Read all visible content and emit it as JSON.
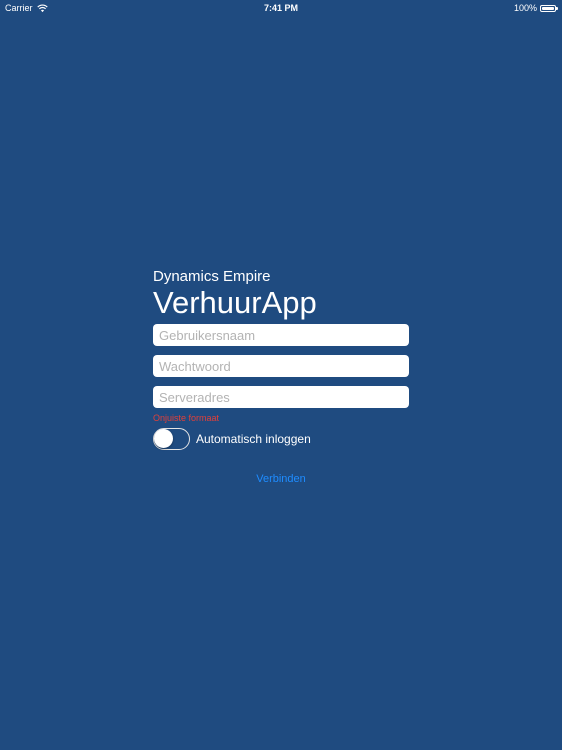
{
  "status_bar": {
    "carrier": "Carrier",
    "time": "7:41 PM",
    "battery": "100%",
    "battery_level": 1.0,
    "wifi_icon": "wifi-icon",
    "battery_icon": "battery-icon"
  },
  "login": {
    "company": "Dynamics Empire",
    "app_title": "VerhuurApp",
    "username_placeholder": "Gebruikersnaam",
    "password_placeholder": "Wachtwoord",
    "server_placeholder": "Serveradres",
    "error_text": "Onjuiste formaat",
    "auto_login_label": "Automatisch inloggen",
    "auto_login_on": false,
    "connect_label": "Verbinden"
  },
  "colors": {
    "background": "#1f4b80",
    "accent": "#1e8cff",
    "error": "#e0403a"
  }
}
